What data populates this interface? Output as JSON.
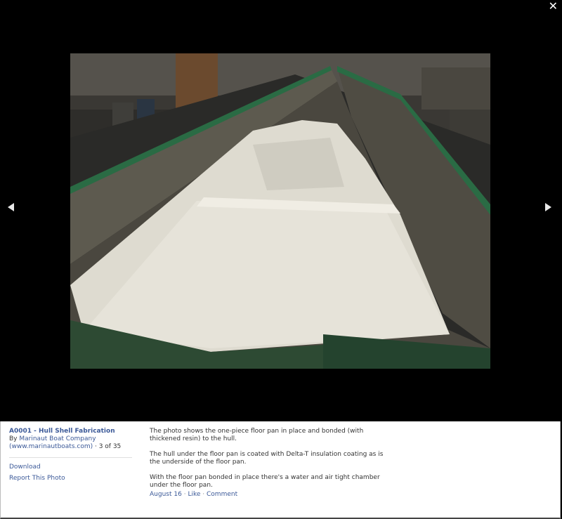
{
  "viewer": {
    "close_label": "✕",
    "prev_label": "previous",
    "next_label": "next"
  },
  "album": {
    "title": "A0001 - Hull Shell Fabrication",
    "by_prefix": "By ",
    "owner": "Marinaut Boat Company",
    "owner_url": "(www.marinautboats.com)",
    "position": "· 3 of 35"
  },
  "actions": {
    "download": "Download",
    "report": "Report This Photo"
  },
  "caption": {
    "paragraphs": [
      "The photo shows the one-piece floor pan in place and bonded (with thickened resin) to the hull.",
      "The hull under the floor pan is coated with Delta-T insulation coating as is the underside of the floor pan.",
      "With the floor pan bonded in place there's a water and air tight chamber under the floor pan."
    ]
  },
  "meta": {
    "date": "August 16",
    "like": "Like",
    "comment": "Comment",
    "separator": "·"
  },
  "colors": {
    "link": "#3b5998",
    "background": "#000000",
    "panel": "#ffffff"
  }
}
